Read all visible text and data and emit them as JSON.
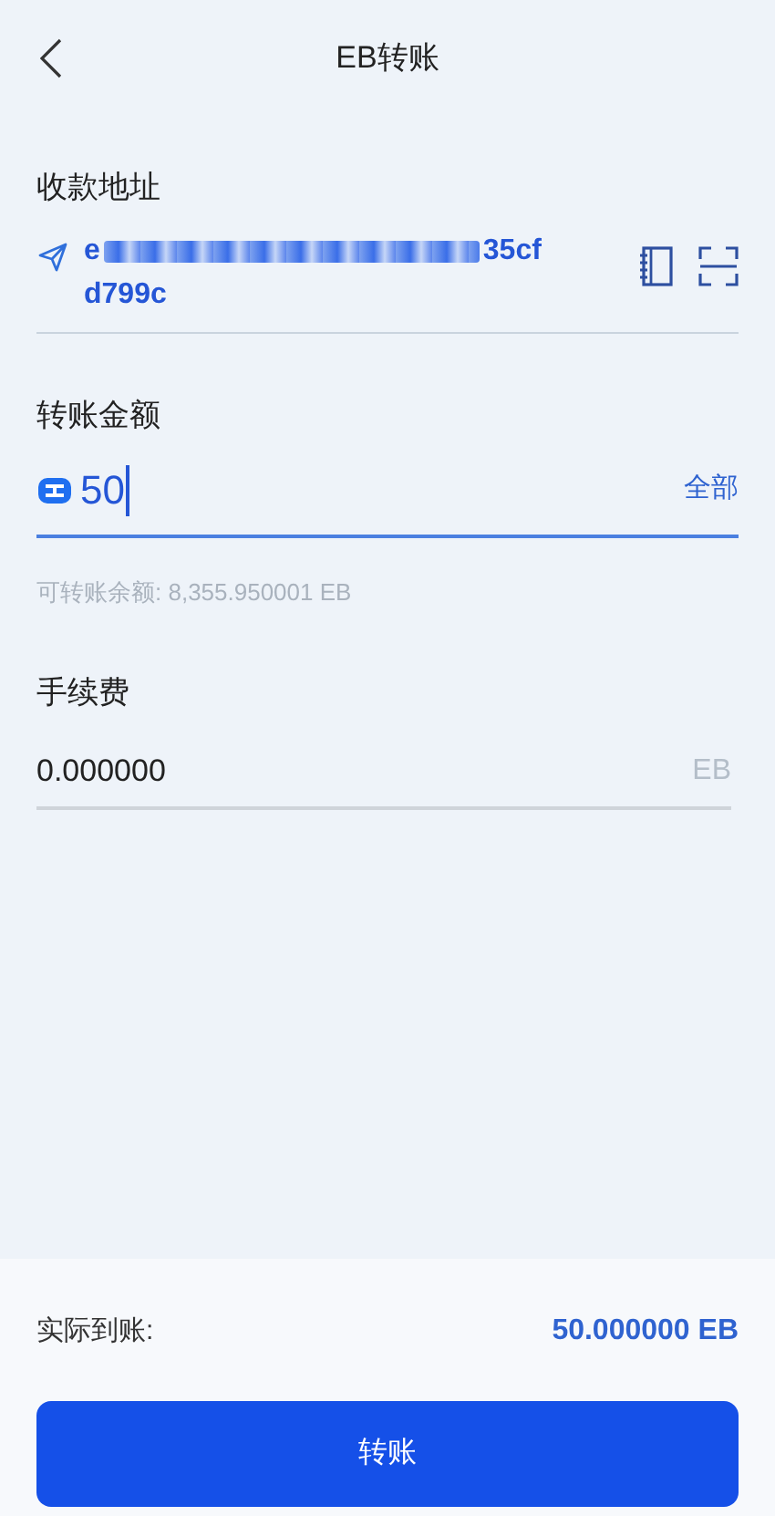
{
  "header": {
    "title": "EB转账"
  },
  "address": {
    "label": "收款地址",
    "start": "e",
    "end": "35cf",
    "line_2": "d799c"
  },
  "amount": {
    "label": "转账金额",
    "value": "50",
    "all_button": "全部",
    "focused": true,
    "balance": "可转账余额: 8,355.950001 EB"
  },
  "fee": {
    "label": "手续费",
    "value": "0.000000",
    "unit": "EB"
  },
  "summary": {
    "label": "实际到账:",
    "value": "50.000000 EB"
  },
  "submit": {
    "label": "转账"
  }
}
